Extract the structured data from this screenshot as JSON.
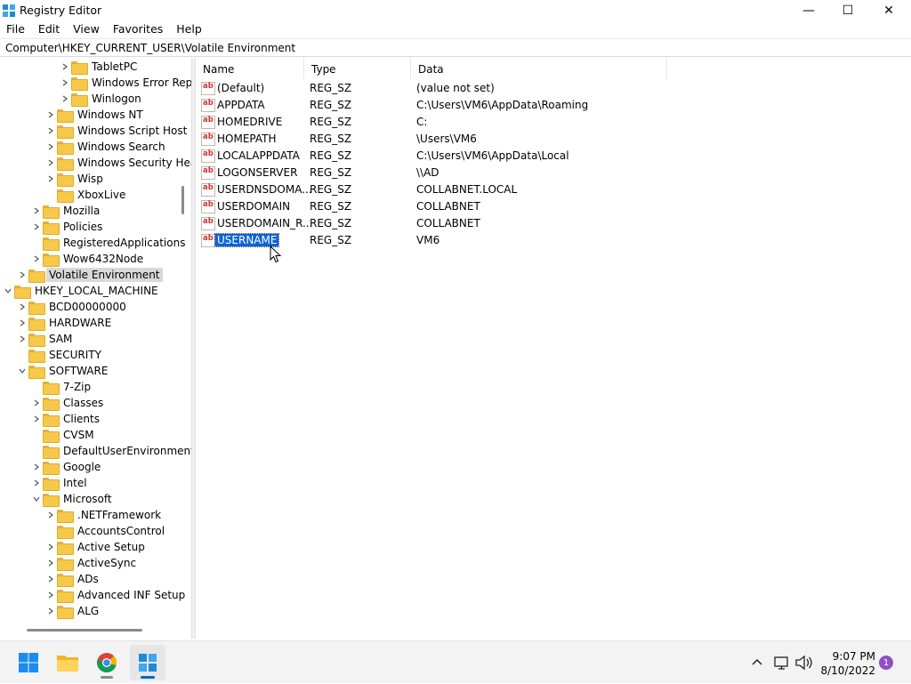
{
  "window": {
    "title": "Registry Editor",
    "controls": {
      "minimize": "—",
      "maximize": "☐",
      "close": "✕"
    }
  },
  "menu": [
    "File",
    "Edit",
    "View",
    "Favorites",
    "Help"
  ],
  "address": "Computer\\HKEY_CURRENT_USER\\Volatile Environment",
  "tree": [
    {
      "label": "TabletPC",
      "level": 4,
      "expander": "collapsed"
    },
    {
      "label": "Windows Error Reporting",
      "level": 4,
      "expander": "collapsed"
    },
    {
      "label": "Winlogon",
      "level": 4,
      "expander": "collapsed"
    },
    {
      "label": "Windows NT",
      "level": 3,
      "expander": "collapsed"
    },
    {
      "label": "Windows Script Host",
      "level": 3,
      "expander": "collapsed"
    },
    {
      "label": "Windows Search",
      "level": 3,
      "expander": "collapsed"
    },
    {
      "label": "Windows Security Health",
      "level": 3,
      "expander": "collapsed"
    },
    {
      "label": "Wisp",
      "level": 3,
      "expander": "collapsed"
    },
    {
      "label": "XboxLive",
      "level": 3,
      "expander": "none"
    },
    {
      "label": "Mozilla",
      "level": 2,
      "expander": "collapsed"
    },
    {
      "label": "Policies",
      "level": 2,
      "expander": "collapsed"
    },
    {
      "label": "RegisteredApplications",
      "level": 2,
      "expander": "none"
    },
    {
      "label": "Wow6432Node",
      "level": 2,
      "expander": "collapsed"
    },
    {
      "label": "Volatile Environment",
      "level": 1,
      "expander": "collapsed",
      "selected": true
    },
    {
      "label": "HKEY_LOCAL_MACHINE",
      "level": 0,
      "expander": "expanded"
    },
    {
      "label": "BCD00000000",
      "level": 1,
      "expander": "collapsed"
    },
    {
      "label": "HARDWARE",
      "level": 1,
      "expander": "collapsed"
    },
    {
      "label": "SAM",
      "level": 1,
      "expander": "collapsed"
    },
    {
      "label": "SECURITY",
      "level": 1,
      "expander": "none"
    },
    {
      "label": "SOFTWARE",
      "level": 1,
      "expander": "expanded"
    },
    {
      "label": "7-Zip",
      "level": 2,
      "expander": "none"
    },
    {
      "label": "Classes",
      "level": 2,
      "expander": "collapsed"
    },
    {
      "label": "Clients",
      "level": 2,
      "expander": "collapsed"
    },
    {
      "label": "CVSM",
      "level": 2,
      "expander": "none"
    },
    {
      "label": "DefaultUserEnvironment",
      "level": 2,
      "expander": "none"
    },
    {
      "label": "Google",
      "level": 2,
      "expander": "collapsed"
    },
    {
      "label": "Intel",
      "level": 2,
      "expander": "collapsed"
    },
    {
      "label": "Microsoft",
      "level": 2,
      "expander": "expanded"
    },
    {
      "label": ".NETFramework",
      "level": 3,
      "expander": "collapsed"
    },
    {
      "label": "AccountsControl",
      "level": 3,
      "expander": "none"
    },
    {
      "label": "Active Setup",
      "level": 3,
      "expander": "collapsed"
    },
    {
      "label": "ActiveSync",
      "level": 3,
      "expander": "collapsed"
    },
    {
      "label": "ADs",
      "level": 3,
      "expander": "collapsed"
    },
    {
      "label": "Advanced INF Setup",
      "level": 3,
      "expander": "collapsed"
    },
    {
      "label": "ALG",
      "level": 3,
      "expander": "collapsed"
    }
  ],
  "columns": {
    "name": "Name",
    "type": "Type",
    "data": "Data"
  },
  "values": [
    {
      "name": "(Default)",
      "type": "REG_SZ",
      "data": "(value not set)"
    },
    {
      "name": "APPDATA",
      "type": "REG_SZ",
      "data": "C:\\Users\\VM6\\AppData\\Roaming"
    },
    {
      "name": "HOMEDRIVE",
      "type": "REG_SZ",
      "data": "C:"
    },
    {
      "name": "HOMEPATH",
      "type": "REG_SZ",
      "data": "\\Users\\VM6"
    },
    {
      "name": "LOCALAPPDATA",
      "type": "REG_SZ",
      "data": "C:\\Users\\VM6\\AppData\\Local"
    },
    {
      "name": "LOGONSERVER",
      "type": "REG_SZ",
      "data": "\\\\AD"
    },
    {
      "name": "USERDNSDOMA...",
      "type": "REG_SZ",
      "data": "COLLABNET.LOCAL"
    },
    {
      "name": "USERDOMAIN",
      "type": "REG_SZ",
      "data": "COLLABNET"
    },
    {
      "name": "USERDOMAIN_R...",
      "type": "REG_SZ",
      "data": "COLLABNET"
    },
    {
      "name": "USERNAME",
      "type": "REG_SZ",
      "data": "VM6",
      "selected": true
    }
  ],
  "value_icon_text": "ab",
  "taskbar": {
    "apps": [
      "start-icon",
      "file-explorer-icon",
      "chrome-icon",
      "regedit-icon"
    ],
    "time": "9:07 PM",
    "date": "8/10/2022",
    "notification_count": "1"
  },
  "colors": {
    "selection": "#0a64d6",
    "folder": "#f7c948",
    "accent": "#0067c0"
  }
}
